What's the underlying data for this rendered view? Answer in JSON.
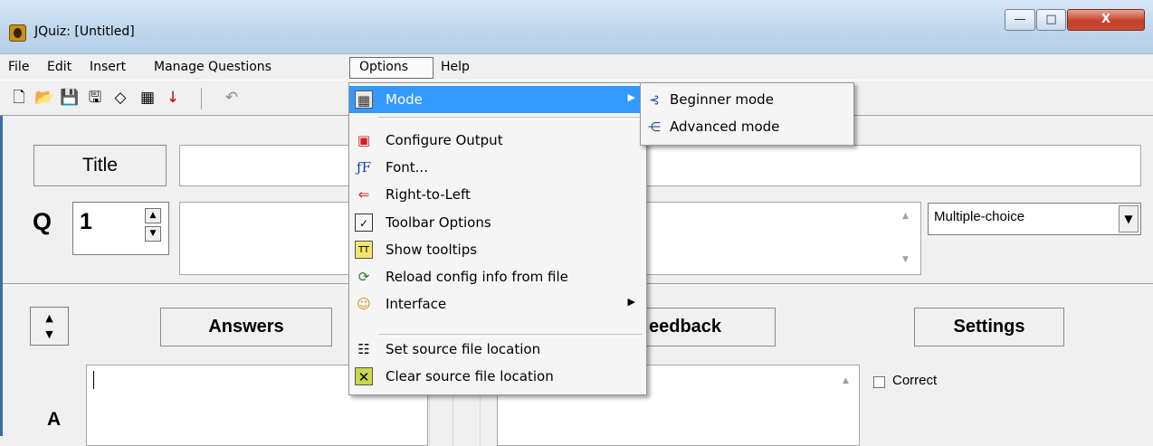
{
  "window": {
    "title": "JQuiz: [Untitled]",
    "minimize_glyph": "—",
    "maximize_glyph": "□",
    "close_glyph": "X"
  },
  "menubar": {
    "items": [
      "File",
      "Edit",
      "Insert",
      "Manage Questions",
      "Options",
      "Help"
    ]
  },
  "toolbar": {
    "icons": [
      "new-file-icon",
      "open-folder-icon",
      "save-icon",
      "save-as-icon",
      "erase-icon",
      "export-icon",
      "download-arrow-icon",
      "undo-icon"
    ]
  },
  "question": {
    "title_button": "Title",
    "title_value": "",
    "q_label": "Q",
    "q_number": "1",
    "q_text": "",
    "q_type": "Multiple-choice"
  },
  "answers": {
    "answers_button": "Answers",
    "feedback_button": "eedback",
    "settings_button": "Settings",
    "answer_label": "A",
    "correct_label": "Correct",
    "correct_checked": false
  },
  "options_menu": {
    "items": [
      {
        "label": "Mode",
        "icon": "mode-icon",
        "submenu": true
      },
      {
        "label": "Configure Output",
        "icon": "configure-output-icon"
      },
      {
        "label": "Font...",
        "icon": "font-icon"
      },
      {
        "label": "Right-to-Left",
        "icon": "right-to-left-icon"
      },
      {
        "label": "Toolbar Options",
        "icon": "toolbar-options-icon"
      },
      {
        "label": "Show tooltips",
        "icon": "tooltips-icon"
      },
      {
        "label": "Reload config info from file",
        "icon": "reload-config-icon"
      },
      {
        "label": "Interface",
        "icon": "interface-icon",
        "submenu": true
      },
      {
        "label": "Set source file location",
        "icon": "set-source-icon"
      },
      {
        "label": "Clear source file location",
        "icon": "clear-source-icon"
      }
    ]
  },
  "mode_submenu": {
    "items": [
      {
        "label": "Beginner mode",
        "icon": "beginner-mode-icon"
      },
      {
        "label": "Advanced mode",
        "icon": "advanced-mode-icon"
      }
    ]
  },
  "colors": {
    "menu_highlight": "#3399ff",
    "title_bar": "#c3d9ee",
    "close_button": "#c4412a"
  }
}
